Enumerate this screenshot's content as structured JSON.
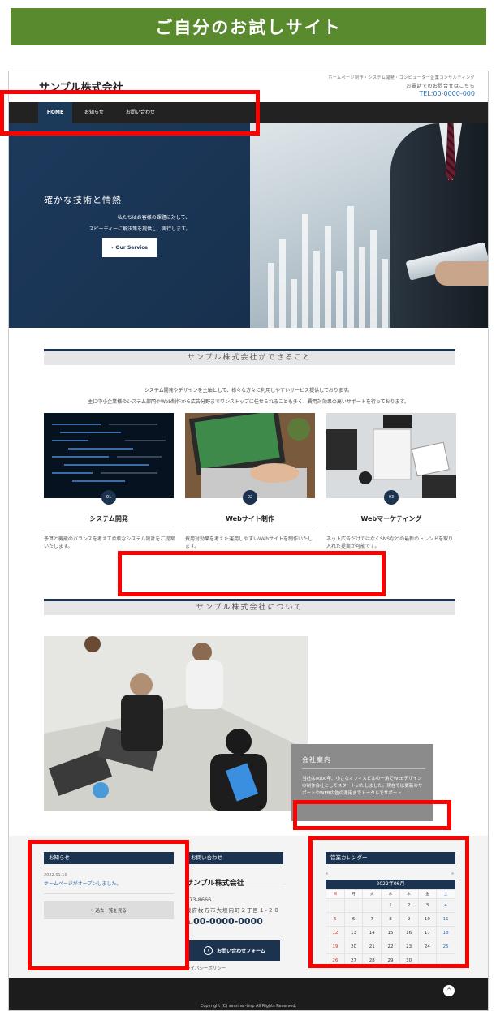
{
  "banner": {
    "title": "ご自分のお試しサイト"
  },
  "header": {
    "logo": "サンプル株式会社",
    "tagline": "ホームページ制作・システム開発・コンピューター企業コンサルティング",
    "contact_note": "お電話でのお問合せはこちら",
    "tel": "TEL:00-0000-000"
  },
  "nav": {
    "items": [
      "HOME",
      "お知らせ",
      "お問い合わせ"
    ],
    "active": "HOME"
  },
  "hero": {
    "title": "確かな技術と情熱",
    "sub1": "私たちはお客様の課題に対して、",
    "sub2": "スピーディーに解決策を提供し、実行します。",
    "button": "Our Service"
  },
  "services": {
    "heading": "サンプル株式会社ができること",
    "desc1": "システム開発やデザインを主軸として、様々な方々に利用しやすいサービス提供しております。",
    "desc2": "主に中小企業様のシステム部門やWeb制作から広告分野までワンストップに任せられることも多く、費用対効果の高いサポートを行っております。",
    "items": [
      {
        "num": "01",
        "title": "システム開発",
        "desc": "予算と機能のバランスを考えて柔軟なシステム設計をご提案いたします。"
      },
      {
        "num": "02",
        "title": "Webサイト制作",
        "desc": "費用対効果を考えた運用しやすいWebサイトを制作いたします。"
      },
      {
        "num": "03",
        "title": "Webマーケティング",
        "desc": "ネット広告だけではなくSNSなどの最新のトレンドを取り入れた提案が可能です。"
      }
    ]
  },
  "about": {
    "heading": "サンプル株式会社について",
    "company_title": "会社案内",
    "company_text": "当社は0000年、小さなオフィスビルの一角でWEBデザインの制作会社としてスタートいたしました。現在では更新のサポートやWEB広告の運用までトータルでサポート"
  },
  "news_widget": {
    "heading": "お知らせ",
    "date": "2022.01.10",
    "item": "ホームページがオープンしました。",
    "button": "過去一覧を見る"
  },
  "contact_widget": {
    "heading": "お問い合わせ",
    "company": "サンプル株式会社",
    "zip": "573-8666",
    "address": "阪府枚方市大垣内町２丁目１-２０",
    "tel_prefix": "EL:",
    "tel": "00-0000-0000",
    "button": "お問い合わせフォーム",
    "privacy": "ライバシーポリシー"
  },
  "calendar_widget": {
    "heading": "営業カレンダー",
    "prev": "«",
    "next": "»",
    "month": "2022年06月",
    "weekdays": [
      "日",
      "月",
      "火",
      "水",
      "木",
      "金",
      "土"
    ],
    "weeks": [
      [
        "",
        "",
        "",
        "1",
        "2",
        "3",
        "4"
      ],
      [
        "5",
        "6",
        "7",
        "8",
        "9",
        "10",
        "11"
      ],
      [
        "12",
        "13",
        "14",
        "15",
        "16",
        "17",
        "18"
      ],
      [
        "19",
        "20",
        "21",
        "22",
        "23",
        "24",
        "25"
      ],
      [
        "26",
        "27",
        "28",
        "29",
        "30",
        "",
        ""
      ]
    ]
  },
  "footer": {
    "totop": "^",
    "copyright": "Copyright (C) seminar-tmp All Rights Reserved."
  },
  "colors": {
    "accent": "#1c3350",
    "banner": "#5a8a2e",
    "highlight": "#ff0000"
  }
}
